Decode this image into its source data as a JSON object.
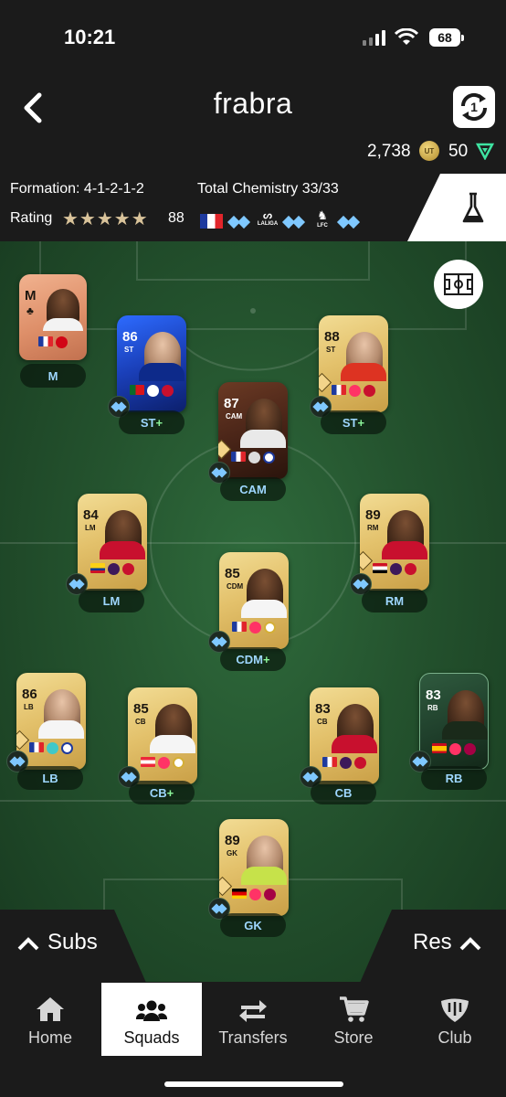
{
  "status": {
    "time": "10:21",
    "battery": "68"
  },
  "header": {
    "title": "frabra",
    "coins": "2,738",
    "coin_icon": "UT",
    "points": "50"
  },
  "info": {
    "formation": "Formation: 4-1-2-1-2",
    "total_chemistry": "Total Chemistry 33/33",
    "rating_label": "Rating",
    "rating_stars": "★★★★★",
    "rating_value": "88",
    "league_laliga": "LALIGA",
    "club_lfc": "LFC"
  },
  "players": [
    {
      "slot": "M",
      "rating": "",
      "pos": "M",
      "label": "M",
      "plus": ""
    },
    {
      "slot": "ST1",
      "rating": "86",
      "pos": "ST",
      "label": "ST",
      "plus": "+"
    },
    {
      "slot": "ST2",
      "rating": "88",
      "pos": "ST",
      "label": "ST",
      "plus": "+"
    },
    {
      "slot": "CAM",
      "rating": "87",
      "pos": "CAM",
      "label": "CAM",
      "plus": ""
    },
    {
      "slot": "LM",
      "rating": "84",
      "pos": "LM",
      "label": "LM",
      "plus": ""
    },
    {
      "slot": "RM",
      "rating": "89",
      "pos": "RM",
      "label": "RM",
      "plus": ""
    },
    {
      "slot": "CDM",
      "rating": "85",
      "pos": "CDM",
      "label": "CDM",
      "plus": "+"
    },
    {
      "slot": "LB",
      "rating": "86",
      "pos": "LB",
      "label": "LB",
      "plus": ""
    },
    {
      "slot": "CB1",
      "rating": "85",
      "pos": "CB",
      "label": "CB",
      "plus": "+"
    },
    {
      "slot": "CB2",
      "rating": "83",
      "pos": "CB",
      "label": "CB",
      "plus": ""
    },
    {
      "slot": "RB",
      "rating": "83",
      "pos": "RB",
      "label": "RB",
      "plus": ""
    },
    {
      "slot": "GK",
      "rating": "89",
      "pos": "GK",
      "label": "GK",
      "plus": ""
    }
  ],
  "bottom": {
    "subs": "Subs",
    "res": "Res"
  },
  "nav": [
    {
      "label": "Home"
    },
    {
      "label": "Squads"
    },
    {
      "label": "Transfers"
    },
    {
      "label": "Store"
    },
    {
      "label": "Club"
    }
  ],
  "colors": {
    "accent_chem": "#7fc8ff",
    "plus": "#8cf59a",
    "card_gold": "#e3c16b"
  }
}
